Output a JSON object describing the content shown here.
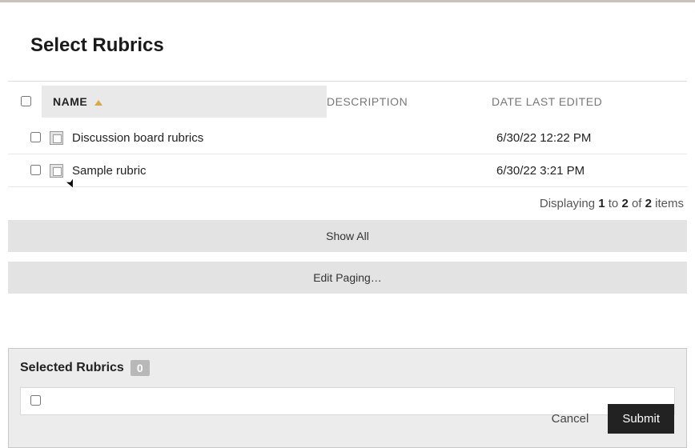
{
  "page": {
    "title": "Select Rubrics"
  },
  "columns": {
    "name": "NAME",
    "description": "DESCRIPTION",
    "date": "DATE LAST EDITED"
  },
  "rows": [
    {
      "name": "Discussion board rubrics",
      "description": "",
      "date": "6/30/22 12:22 PM"
    },
    {
      "name": "Sample rubric",
      "description": "",
      "date": "6/30/22 3:21 PM"
    }
  ],
  "paging": {
    "prefix": "Displaying ",
    "from": "1",
    "to_word": " to ",
    "to": "2",
    "of_word": " of ",
    "total": "2",
    "suffix": " items",
    "show_all": "Show All",
    "edit_paging": "Edit Paging…"
  },
  "selected": {
    "title": "Selected Rubrics",
    "count": "0"
  },
  "actions": {
    "cancel": "Cancel",
    "submit": "Submit"
  }
}
